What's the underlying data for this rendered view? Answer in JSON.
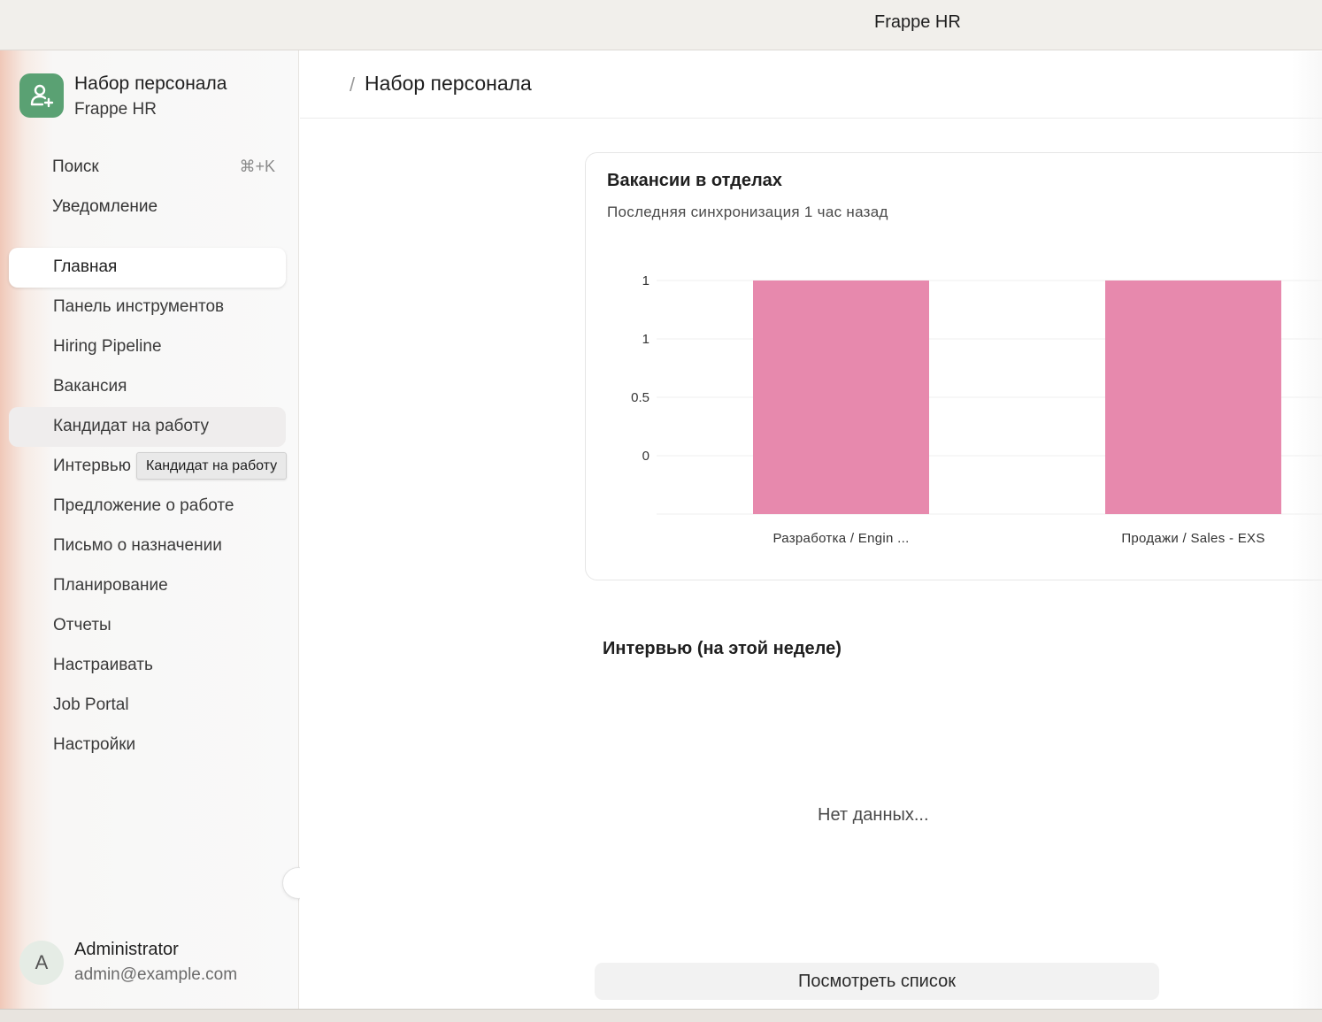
{
  "window": {
    "title": "Frappe HR"
  },
  "app": {
    "name": "Набор персонала",
    "subtitle": "Frappe HR",
    "logo_icon": "user-plus-icon",
    "accent": "#5aa173"
  },
  "search": {
    "label": "Поиск",
    "shortcut": "⌘+K"
  },
  "notifications": {
    "label": "Уведомление"
  },
  "sidebar": {
    "items": [
      {
        "label": "Главная",
        "state": "active"
      },
      {
        "label": "Панель инструментов",
        "state": ""
      },
      {
        "label": "Hiring Pipeline",
        "state": ""
      },
      {
        "label": "Вакансия",
        "state": ""
      },
      {
        "label": "Кандидат на работу",
        "state": "hover"
      },
      {
        "label": "Интервью",
        "state": ""
      },
      {
        "label": "Предложение о работе",
        "state": ""
      },
      {
        "label": "Письмо о назначении",
        "state": ""
      },
      {
        "label": "Планирование",
        "state": ""
      },
      {
        "label": "Отчеты",
        "state": ""
      },
      {
        "label": "Настраивать",
        "state": ""
      },
      {
        "label": "Job Portal",
        "state": ""
      },
      {
        "label": "Настройки",
        "state": ""
      }
    ]
  },
  "tooltip": {
    "text": "Кандидат на работу"
  },
  "user": {
    "initial": "A",
    "name": "Administrator",
    "email": "admin@example.com"
  },
  "header": {
    "separator": "/",
    "title": "Набор персонала"
  },
  "vacancies_card": {
    "title": "Вакансии в отделах",
    "subtitle": "Последняя синхронизация 1 час назад"
  },
  "chart_data": {
    "type": "bar",
    "title": "Вакансии в отделах",
    "categories": [
      "Разработка / Engin ...",
      "Продажи / Sales - EXS"
    ],
    "values": [
      1,
      1
    ],
    "y_ticks": [
      "1",
      "1",
      "0.5",
      "0"
    ],
    "y_tick_values": [
      1.5,
      1,
      0.5,
      0
    ],
    "ylim": [
      -0.5,
      1.5
    ],
    "bar_color": "#e789ad",
    "grid": true,
    "legend": "none"
  },
  "interviews": {
    "title": "Интервью (на этой неделе)",
    "empty_text": "Нет данных...",
    "button_label": "Посмотреть список"
  }
}
